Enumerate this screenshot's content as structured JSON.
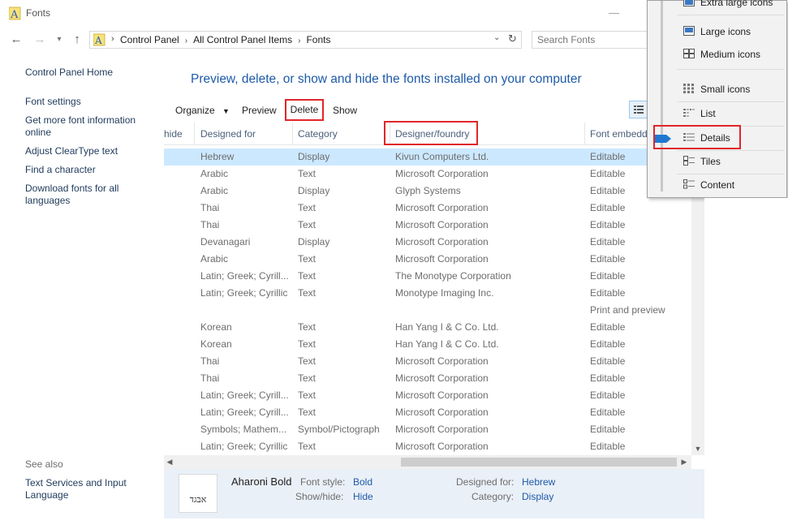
{
  "window": {
    "title": "Fonts"
  },
  "address": {
    "crumbs": [
      "Control Panel",
      "All Control Panel Items",
      "Fonts"
    ],
    "search_placeholder": "Search Fonts"
  },
  "left_pane": {
    "home": "Control Panel Home",
    "links": [
      "Font settings",
      "Get more font information online",
      "Adjust ClearType text",
      "Find a character",
      "Download fonts for all languages"
    ],
    "see_also_title": "See also",
    "see_also_link": "Text Services and Input Language"
  },
  "heading": "Preview, delete, or show and hide the fonts installed on your computer",
  "toolbar": {
    "organize": "Organize",
    "preview": "Preview",
    "delete": "Delete",
    "show": "Show"
  },
  "columns": {
    "hide": "hide",
    "designed_for": "Designed for",
    "category": "Category",
    "designer": "Designer/foundry",
    "embed": "Font embedd"
  },
  "rows": [
    {
      "designed_for": "Hebrew",
      "category": "Display",
      "designer": "Kivun Computers Ltd.",
      "embed": "Editable",
      "selected": true
    },
    {
      "designed_for": "Arabic",
      "category": "Text",
      "designer": "Microsoft Corporation",
      "embed": "Editable"
    },
    {
      "designed_for": "Arabic",
      "category": "Display",
      "designer": "Glyph Systems",
      "embed": "Editable"
    },
    {
      "designed_for": "Thai",
      "category": "Text",
      "designer": "Microsoft Corporation",
      "embed": "Editable"
    },
    {
      "designed_for": "Thai",
      "category": "Text",
      "designer": "Microsoft Corporation",
      "embed": "Editable"
    },
    {
      "designed_for": "Devanagari",
      "category": "Display",
      "designer": "Microsoft Corporation",
      "embed": "Editable"
    },
    {
      "designed_for": "Arabic",
      "category": "Text",
      "designer": "Microsoft Corporation",
      "embed": "Editable"
    },
    {
      "designed_for": "Latin; Greek; Cyrill...",
      "category": "Text",
      "designer": "The Monotype Corporation",
      "embed": "Editable"
    },
    {
      "designed_for": "Latin; Greek; Cyrillic",
      "category": "Text",
      "designer": "Monotype Imaging Inc.",
      "embed": "Editable"
    },
    {
      "designed_for": "",
      "category": "",
      "designer": "",
      "embed": "Print and preview"
    },
    {
      "designed_for": "Korean",
      "category": "Text",
      "designer": "Han Yang I & C Co. Ltd.",
      "embed": "Editable"
    },
    {
      "designed_for": "Korean",
      "category": "Text",
      "designer": "Han Yang I & C Co. Ltd.",
      "embed": "Editable"
    },
    {
      "designed_for": "Thai",
      "category": "Text",
      "designer": "Microsoft Corporation",
      "embed": "Editable"
    },
    {
      "designed_for": "Thai",
      "category": "Text",
      "designer": "Microsoft Corporation",
      "embed": "Editable"
    },
    {
      "designed_for": "Latin; Greek; Cyrill...",
      "category": "Text",
      "designer": "Microsoft Corporation",
      "embed": "Editable"
    },
    {
      "designed_for": "Latin; Greek; Cyrill...",
      "category": "Text",
      "designer": "Microsoft Corporation",
      "embed": "Editable"
    },
    {
      "designed_for": "Symbols; Mathem...",
      "category": "Symbol/Pictograph",
      "designer": "Microsoft Corporation",
      "embed": "Editable"
    },
    {
      "designed_for": "Latin; Greek; Cyrillic",
      "category": "Text",
      "designer": "Microsoft Corporation",
      "embed": "Editable"
    }
  ],
  "details": {
    "font_name": "Aharoni Bold",
    "preview_glyph": "אבגד",
    "font_style_label": "Font style:",
    "font_style": "Bold",
    "show_hide_label": "Show/hide:",
    "show_hide": "Hide",
    "designed_for_label": "Designed for:",
    "designed_for": "Hebrew",
    "category_label": "Category:",
    "category": "Display"
  },
  "view_menu": {
    "items": [
      "Extra large icons",
      "Large icons",
      "Medium icons",
      "Small icons",
      "List",
      "Details",
      "Tiles",
      "Content"
    ]
  },
  "colors": {
    "accent": "#1e5aa8",
    "selection": "#cce8ff",
    "highlight": "#e0262a",
    "pointer": "#1e78d2"
  }
}
